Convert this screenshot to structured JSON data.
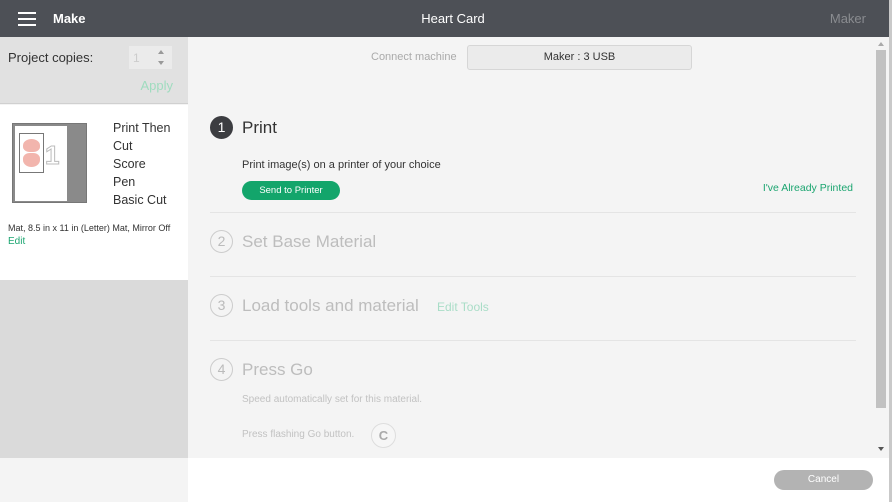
{
  "header": {
    "menu_icon": "hamburger-icon",
    "section": "Make",
    "title": "Heart Card",
    "machine_label": "Maker"
  },
  "left_panel": {
    "copies_label": "Project copies:",
    "copies_value": "1",
    "apply_label": "Apply",
    "mat": {
      "mat_number": "1",
      "operations": [
        "Print Then",
        "Cut",
        "Score",
        "Pen",
        "Basic Cut"
      ],
      "description": "Mat, 8.5 in x 11 in (Letter) Mat, Mirror Off",
      "edit_label": "Edit"
    }
  },
  "main": {
    "connect_label": "Connect machine",
    "machine_value": "Maker : 3 USB",
    "steps": [
      {
        "number": "1",
        "title": "Print",
        "state": "active"
      },
      {
        "number": "2",
        "title": "Set Base Material",
        "state": "inactive"
      },
      {
        "number": "3",
        "title": "Load tools and material",
        "state": "inactive"
      },
      {
        "number": "4",
        "title": "Press Go",
        "state": "inactive"
      }
    ],
    "print_description": "Print image(s) on a printer of your choice",
    "send_to_printer": "Send to Printer",
    "already_printed": "I've Already Printed",
    "edit_tools": "Edit Tools",
    "speed_text": "Speed automatically set for this material.",
    "press_go_text": "Press flashing Go button.",
    "go_icon": "cricut-go-icon",
    "go_glyph": "C"
  },
  "footer": {
    "cancel_label": "Cancel"
  },
  "colors": {
    "header_bg": "#4d5056",
    "accent_green": "#13a56b",
    "link_green": "#1ba570"
  }
}
